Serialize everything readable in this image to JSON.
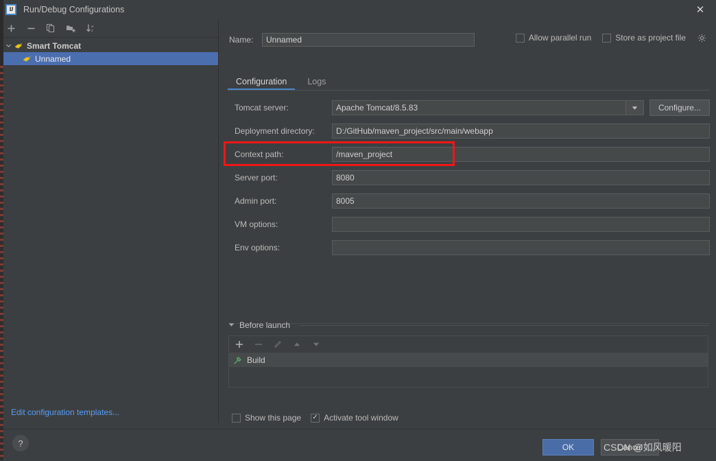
{
  "window": {
    "title": "Run/Debug Configurations",
    "logo_text": "IJ",
    "close_label": "✕"
  },
  "sidebar": {
    "toolbar": [
      {
        "name": "add",
        "glyph": "＋"
      },
      {
        "name": "remove",
        "glyph": "−"
      },
      {
        "name": "copy",
        "glyph": "⎘"
      },
      {
        "name": "save-folder",
        "glyph": "📁"
      },
      {
        "name": "sort-alphabetically",
        "glyph": "↓"
      }
    ],
    "tree": [
      {
        "label": "Smart Tomcat",
        "level": 0,
        "selected": false
      },
      {
        "label": "Unnamed",
        "level": 1,
        "selected": true
      }
    ],
    "edit_templates_link": "Edit configuration templates..."
  },
  "header": {
    "name_label": "Name:",
    "name_value": "Unnamed",
    "allow_parallel_run": {
      "label": "Allow parallel run",
      "checked": false
    },
    "store_as_project_file": {
      "label": "Store as project file",
      "checked": false
    }
  },
  "tabs": [
    {
      "label": "Configuration",
      "active": true
    },
    {
      "label": "Logs",
      "active": false
    }
  ],
  "form": {
    "tomcat_server": {
      "label": "Tomcat server:",
      "value": "Apache Tomcat/8.5.83",
      "browse_icon": "folder-icon",
      "dropdown_glyph": "▼",
      "configure_button": "Configure..."
    },
    "deployment_directory": {
      "label": "Deployment directory:",
      "value": "D:/GitHub/maven_project/src/main/webapp",
      "browse_icon": "folder-icon"
    },
    "context_path": {
      "label": "Context path:",
      "value": "/maven_project",
      "highlighted": true,
      "highlight_color": "#f01616"
    },
    "server_port": {
      "label": "Server port:",
      "value": "8080"
    },
    "admin_port": {
      "label": "Admin port:",
      "value": "8005"
    },
    "vm_options": {
      "label": "VM options:",
      "value": "",
      "expand_icon": "expand-icon"
    },
    "env_options": {
      "label": "Env options:",
      "value": "",
      "list_icon": "list-icon"
    }
  },
  "before_launch": {
    "title": "Before launch",
    "collapse_glyph": "▾",
    "toolbar": [
      {
        "name": "add",
        "glyph": "＋",
        "enabled": true
      },
      {
        "name": "remove",
        "glyph": "−",
        "enabled": false
      },
      {
        "name": "edit",
        "glyph": "✎",
        "enabled": false
      },
      {
        "name": "move-up",
        "glyph": "▲",
        "enabled": false
      },
      {
        "name": "move-down",
        "glyph": "▼",
        "enabled": false
      }
    ],
    "items": [
      {
        "label": "Build",
        "icon": "hammer-icon"
      }
    ]
  },
  "bottom_options": {
    "show_this_page": {
      "label": "Show this page",
      "checked": false
    },
    "activate_tool_window": {
      "label": "Activate tool window",
      "checked": true
    }
  },
  "footer": {
    "help_glyph": "?",
    "ok_label": "OK",
    "cancel_label": "Cancel",
    "watermark": "CSDN @如风暖阳"
  },
  "colors": {
    "accent_blue": "#4a88c7",
    "selection_blue": "#4b6eaf",
    "link_blue": "#589df6",
    "annotation_red": "#f01616",
    "panel_bg": "#3c3f41",
    "field_bg": "#45494a"
  }
}
